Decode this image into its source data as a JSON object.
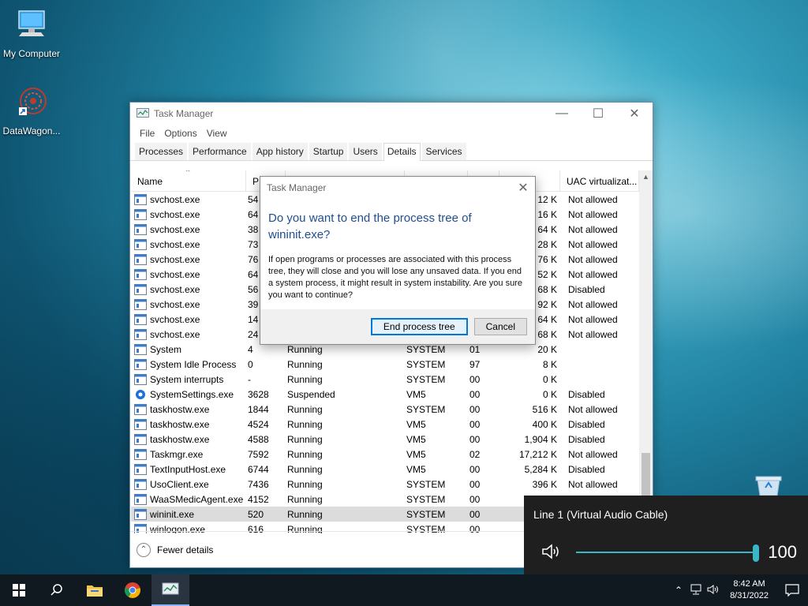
{
  "desktop": {
    "icons": [
      {
        "label": "My Computer",
        "icon": "monitor-icon"
      },
      {
        "label": "DataWagon...",
        "icon": "datawagon-icon"
      }
    ]
  },
  "task_manager": {
    "title": "Task Manager",
    "menu": [
      "File",
      "Options",
      "View"
    ],
    "tabs": [
      "Processes",
      "Performance",
      "App history",
      "Startup",
      "Users",
      "Details",
      "Services"
    ],
    "active_tab": "Details",
    "columns": [
      "Name",
      "PI",
      "",
      "",
      "",
      "y (a...",
      "UAC virtualizat..."
    ],
    "rows": [
      {
        "name": "svchost.exe",
        "pid": "54",
        "status": "",
        "user": "",
        "cpu": "",
        "mem": "12 K",
        "uac": "Not allowed"
      },
      {
        "name": "svchost.exe",
        "pid": "64",
        "status": "",
        "user": "",
        "cpu": "",
        "mem": "16 K",
        "uac": "Not allowed"
      },
      {
        "name": "svchost.exe",
        "pid": "38",
        "status": "",
        "user": "",
        "cpu": "",
        "mem": "64 K",
        "uac": "Not allowed"
      },
      {
        "name": "svchost.exe",
        "pid": "73",
        "status": "",
        "user": "",
        "cpu": "",
        "mem": "28 K",
        "uac": "Not allowed"
      },
      {
        "name": "svchost.exe",
        "pid": "76",
        "status": "",
        "user": "",
        "cpu": "",
        "mem": "76 K",
        "uac": "Not allowed"
      },
      {
        "name": "svchost.exe",
        "pid": "64",
        "status": "",
        "user": "",
        "cpu": "",
        "mem": "52 K",
        "uac": "Not allowed"
      },
      {
        "name": "svchost.exe",
        "pid": "56",
        "status": "",
        "user": "",
        "cpu": "",
        "mem": "68 K",
        "uac": "Disabled"
      },
      {
        "name": "svchost.exe",
        "pid": "39",
        "status": "",
        "user": "",
        "cpu": "",
        "mem": "92 K",
        "uac": "Not allowed"
      },
      {
        "name": "svchost.exe",
        "pid": "14",
        "status": "",
        "user": "",
        "cpu": "",
        "mem": "64 K",
        "uac": "Not allowed"
      },
      {
        "name": "svchost.exe",
        "pid": "24",
        "status": "",
        "user": "",
        "cpu": "",
        "mem": "68 K",
        "uac": "Not allowed"
      },
      {
        "name": "System",
        "pid": "4",
        "status": "Running",
        "user": "SYSTEM",
        "cpu": "01",
        "mem": "20 K",
        "uac": ""
      },
      {
        "name": "System Idle Process",
        "pid": "0",
        "status": "Running",
        "user": "SYSTEM",
        "cpu": "97",
        "mem": "8 K",
        "uac": ""
      },
      {
        "name": "System interrupts",
        "pid": "-",
        "status": "Running",
        "user": "SYSTEM",
        "cpu": "00",
        "mem": "0 K",
        "uac": ""
      },
      {
        "name": "SystemSettings.exe",
        "pid": "3628",
        "status": "Suspended",
        "user": "VM5",
        "cpu": "00",
        "mem": "0 K",
        "uac": "Disabled"
      },
      {
        "name": "taskhostw.exe",
        "pid": "1844",
        "status": "Running",
        "user": "SYSTEM",
        "cpu": "00",
        "mem": "516 K",
        "uac": "Not allowed"
      },
      {
        "name": "taskhostw.exe",
        "pid": "4524",
        "status": "Running",
        "user": "VM5",
        "cpu": "00",
        "mem": "400 K",
        "uac": "Disabled"
      },
      {
        "name": "taskhostw.exe",
        "pid": "4588",
        "status": "Running",
        "user": "VM5",
        "cpu": "00",
        "mem": "1,904 K",
        "uac": "Disabled"
      },
      {
        "name": "Taskmgr.exe",
        "pid": "7592",
        "status": "Running",
        "user": "VM5",
        "cpu": "02",
        "mem": "17,212 K",
        "uac": "Not allowed"
      },
      {
        "name": "TextInputHost.exe",
        "pid": "6744",
        "status": "Running",
        "user": "VM5",
        "cpu": "00",
        "mem": "5,284 K",
        "uac": "Disabled"
      },
      {
        "name": "UsoClient.exe",
        "pid": "7436",
        "status": "Running",
        "user": "SYSTEM",
        "cpu": "00",
        "mem": "396 K",
        "uac": "Not allowed"
      },
      {
        "name": "WaaSMedicAgent.exe",
        "pid": "4152",
        "status": "Running",
        "user": "SYSTEM",
        "cpu": "00",
        "mem": "",
        "uac": ""
      },
      {
        "name": "wininit.exe",
        "pid": "520",
        "status": "Running",
        "user": "SYSTEM",
        "cpu": "00",
        "mem": "",
        "uac": ""
      },
      {
        "name": "winlogon.exe",
        "pid": "616",
        "status": "Running",
        "user": "SYSTEM",
        "cpu": "00",
        "mem": "",
        "uac": ""
      }
    ],
    "selected_row": "wininit.exe",
    "footer": "Fewer details"
  },
  "dialog": {
    "title": "Task Manager",
    "heading": "Do you want to end the process tree of wininit.exe?",
    "body": "If open programs or processes are associated with this process tree, they will close and you will lose any unsaved data. If you end a system process, it might result in system instability. Are you sure you want to continue?",
    "primary_button": "End process tree",
    "cancel_button": "Cancel"
  },
  "volume_flyout": {
    "device": "Line 1 (Virtual Audio Cable)",
    "level": 100,
    "accent": "#3bb5c8"
  },
  "taskbar": {
    "apps": [
      "start-icon",
      "search-icon",
      "file-explorer-icon",
      "chrome-icon",
      "task-manager-icon"
    ],
    "clock_time": "8:42 AM",
    "clock_date": "8/31/2022"
  }
}
